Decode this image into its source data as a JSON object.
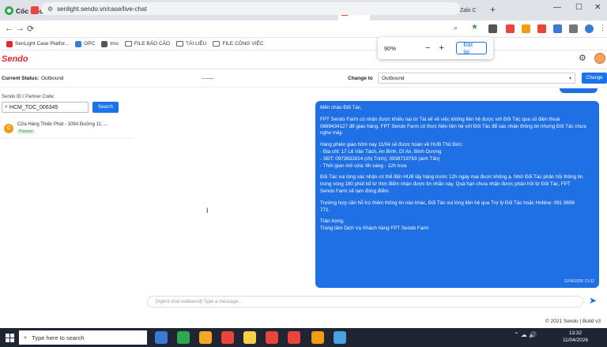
{
  "browser": {
    "brand": "Cốc Cốc",
    "tabs": [
      {
        "label": "",
        "color": "#e8453c"
      },
      {
        "label": "",
        "color": "#e8453c"
      },
      {
        "label": "",
        "color": "#34a853"
      },
      {
        "label": "",
        "color": "#1a73e8"
      },
      {
        "label": "",
        "color": "#34a853"
      },
      {
        "label": "",
        "color": "#34a853"
      },
      {
        "label": "[Claim",
        "color": "#34a853"
      },
      {
        "label": "Danh",
        "color": "#e8453c"
      },
      {
        "label": "Chi tiế",
        "color": "#e8453c"
      },
      {
        "label": "Chi tiế",
        "color": "#e8453c"
      },
      {
        "label": "Chi tiế",
        "color": "#e8453c"
      },
      {
        "label": "Case",
        "color": "#e8453c"
      },
      {
        "label": "Li",
        "color": "#e8453c"
      },
      {
        "label": "",
        "color": "#2ea84f"
      },
      {
        "label": "Danh",
        "color": "#34a853"
      },
      {
        "label": "Zalo C",
        "color": "#1a73e8"
      }
    ],
    "url": "senlight.sendo.vn/case/live-chat",
    "bookmarks": [
      {
        "label": "SenLight Case Platfor...",
        "icon": "sendo-favicon"
      },
      {
        "label": "OPC",
        "icon": "opc-favicon"
      },
      {
        "label": "tms",
        "icon": "tms-favicon"
      },
      {
        "label": "FILE BÁO CÁO",
        "icon": "folder-icon"
      },
      {
        "label": "TÀI LIỆU",
        "icon": "folder-icon"
      },
      {
        "label": "FILE CÔNG VIỆC",
        "icon": "folder-icon"
      }
    ],
    "zoom": {
      "value": "90%",
      "reset_label": "Đặt lại"
    }
  },
  "app": {
    "logo": "Sendo",
    "status": {
      "label": "Current Status:",
      "value": "Outbound",
      "dashes": "-------",
      "change_label": "Change to",
      "change_value": "Outbound",
      "change_button": "Change"
    },
    "left": {
      "id_label": "Sendo ID / Partner Code:",
      "search_value": "HCM_TDC_006345",
      "search_button": "Search",
      "contact": {
        "initial": "C",
        "name": "Cửa Hàng Thiên Phát - 109A Đường 11, ...",
        "tag": "Partner"
      }
    },
    "chat": {
      "message_lines": [
        "Mến chào Đối Tác,",
        "",
        "FPT Sendo Farm có nhận được khiếu nại từ Tài xế về việc không liên hệ được với Đối Tác qua số điện thoại",
        "0869434127 để giao hàng. FPT Sendo Farm có thực hiện liên hệ với Đối Tác để xác nhận thông tin nhưng Đối Tác chưa",
        "nghe máy.",
        "",
        "Hàng phiên giao hôm nay 11/04 sẽ được hoàn về HUB Thủ Đức:",
        "- Địa chỉ: 17 Lê Văn Tách, An Bình, Dĩ An, Bình Dương",
        "- SĐT: 0973832814 (chị Trinh); 0938719783 (anh Tấn)",
        "- Thời gian mở cửa: 6h sáng - 12h trưa",
        "",
        "Đối Tác vui lòng xác nhận có thể đến HUB lấy hàng trước 12h ngày mai được không ạ. Nhờ Đối Tác phản hồi thông tin",
        "trong vòng 180 phút kể từ thời điểm nhận được tin nhắn này. Quá hạn chưa nhận được phản hồi từ Đối Tác, FPT",
        "Sendo Farm sẽ tạm đóng điểm.",
        "",
        "Trường hợp cần hỗ trợ thêm thông tin nào khác, Đối Tác vui lòng liên hệ qua Trợ lý Đối Tác hoặc Hotline: 091 9696",
        "771.",
        "",
        "Trân trọng,",
        "Trung tâm Dịch Vụ Khách hàng FPT Sendo Farm"
      ],
      "timestamp": "11/04/2026 13:32",
      "input_placeholder": "[Agent chat outbound] Type a message..."
    },
    "footer": "© 2021 Sendo | Build v3"
  },
  "taskbar": {
    "search_placeholder": "Type here to search",
    "time": "13:32",
    "date": "11/04/2026",
    "apps": [
      "#3a7bd5",
      "#2ea84f",
      "#f5a623",
      "#e8453c",
      "#f7d046",
      "#e8453c",
      "#e8453c",
      "#f39c12",
      "#4aa3df"
    ]
  },
  "colors": {
    "accent": "#1a73e8",
    "sendo_red": "#e7252d",
    "bubble": "#1f6fe5"
  }
}
